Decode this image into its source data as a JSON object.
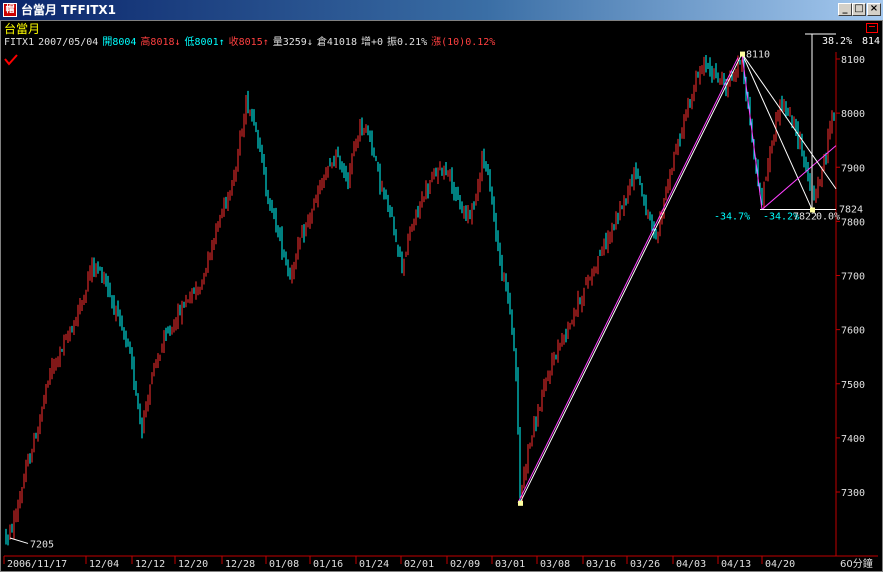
{
  "window": {
    "title": "台當月 TFFITX1",
    "icon_text": "帽",
    "buttons": {
      "minimize": "_",
      "maximize": "□",
      "close": "×"
    }
  },
  "panel": {
    "name": "台當月",
    "fib_label": "38.2%",
    "fib_value": "814"
  },
  "info": {
    "symbol": "FITX1",
    "date": "2007/05/04",
    "open": "開8004",
    "high": "高8018↓",
    "low": "低8001↑",
    "close": "收8015↑",
    "volume": "量3259↓",
    "oi": "倉41018",
    "oi_change": "增+0",
    "amplitude": "振0.21%",
    "change": "漲(10)0.12%"
  },
  "colors": {
    "up": "#ff3030",
    "down": "#00ffff",
    "axis": "#c00000",
    "text": "#e0e0e0",
    "pink": "#ff40ff",
    "white": "#ffffff"
  },
  "chart_data": {
    "type": "candlestick",
    "ylim": [
      7200,
      8140
    ],
    "yticks": [
      "8100",
      "8000",
      "7900",
      "7800",
      "7700",
      "7600",
      "7500",
      "7400",
      "7300"
    ],
    "yticks_num": [
      8100,
      8000,
      7900,
      7800,
      7700,
      7600,
      7500,
      7400,
      7300
    ],
    "xticks": [
      "2006/11/17",
      "12/04",
      "12/12",
      "12/20",
      "12/28",
      "01/08",
      "01/16",
      "01/24",
      "02/01",
      "02/09",
      "03/01",
      "03/08",
      "03/16",
      "03/26",
      "04/03",
      "04/13",
      "04/20"
    ],
    "x_unit": "60分鐘",
    "annotations": [
      {
        "text": "7205",
        "value": 7205
      },
      {
        "text": "8110",
        "value": 8110
      },
      {
        "text": "-34.7%",
        "value": 7830
      },
      {
        "text": "-34.2%",
        "value": 7830
      },
      {
        "text": "7822",
        "value": 7830
      },
      {
        "text": "0.0%",
        "value": 7830
      },
      {
        "text": "7824",
        "value": 7824
      }
    ],
    "key_points": {
      "low_2006": 7205,
      "low_march": 7280,
      "high_april": 8110,
      "retrace_low": 7822
    },
    "anchors": [
      [
        0,
        7255
      ],
      [
        8,
        7210
      ],
      [
        16,
        7260
      ],
      [
        26,
        7340
      ],
      [
        38,
        7420
      ],
      [
        50,
        7520
      ],
      [
        66,
        7580
      ],
      [
        80,
        7640
      ],
      [
        92,
        7720
      ],
      [
        104,
        7700
      ],
      [
        118,
        7620
      ],
      [
        130,
        7550
      ],
      [
        142,
        7420
      ],
      [
        150,
        7500
      ],
      [
        162,
        7570
      ],
      [
        176,
        7620
      ],
      [
        188,
        7660
      ],
      [
        200,
        7680
      ],
      [
        212,
        7760
      ],
      [
        224,
        7830
      ],
      [
        236,
        7900
      ],
      [
        246,
        8020
      ],
      [
        256,
        7980
      ],
      [
        266,
        7860
      ],
      [
        278,
        7780
      ],
      [
        290,
        7700
      ],
      [
        300,
        7760
      ],
      [
        312,
        7820
      ],
      [
        324,
        7880
      ],
      [
        336,
        7920
      ],
      [
        348,
        7880
      ],
      [
        360,
        7980
      ],
      [
        370,
        7960
      ],
      [
        380,
        7870
      ],
      [
        392,
        7800
      ],
      [
        402,
        7720
      ],
      [
        412,
        7790
      ],
      [
        424,
        7850
      ],
      [
        436,
        7890
      ],
      [
        448,
        7900
      ],
      [
        456,
        7840
      ],
      [
        466,
        7810
      ],
      [
        474,
        7830
      ],
      [
        482,
        7920
      ],
      [
        490,
        7870
      ],
      [
        500,
        7720
      ],
      [
        510,
        7640
      ],
      [
        516,
        7520
      ],
      [
        520,
        7290
      ],
      [
        528,
        7380
      ],
      [
        540,
        7460
      ],
      [
        552,
        7540
      ],
      [
        564,
        7590
      ],
      [
        576,
        7640
      ],
      [
        588,
        7690
      ],
      [
        600,
        7740
      ],
      [
        614,
        7790
      ],
      [
        626,
        7850
      ],
      [
        636,
        7900
      ],
      [
        646,
        7820
      ],
      [
        656,
        7760
      ],
      [
        666,
        7860
      ],
      [
        676,
        7930
      ],
      [
        686,
        8000
      ],
      [
        696,
        8060
      ],
      [
        706,
        8090
      ],
      [
        716,
        8070
      ],
      [
        726,
        8050
      ],
      [
        736,
        8080
      ],
      [
        742,
        8100
      ],
      [
        750,
        7980
      ],
      [
        756,
        7890
      ],
      [
        762,
        7840
      ],
      [
        770,
        7930
      ],
      [
        780,
        8020
      ],
      [
        790,
        7990
      ],
      [
        800,
        7950
      ],
      [
        808,
        7880
      ],
      [
        814,
        7840
      ],
      [
        820,
        7880
      ],
      [
        826,
        7920
      ],
      [
        832,
        8010
      ],
      [
        836,
        8000
      ]
    ]
  }
}
